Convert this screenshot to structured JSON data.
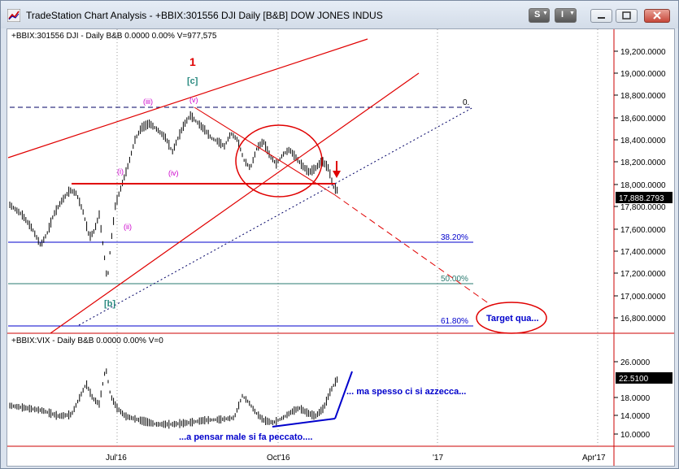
{
  "window": {
    "title": "TradeStation Chart Analysis - +BBIX:301556 DJI Daily [B&B] DOW JONES INDUS",
    "s_button": "S",
    "i_button": "I"
  },
  "upper_pane": {
    "header": "+BBIX:301556 DJI - Daily  B&B  0.0000  0.00%  V=977,575",
    "price_axis": [
      "19,200.0000",
      "19,000.0000",
      "18,800.0000",
      "18,600.0000",
      "18,400.0000",
      "18,200.0000",
      "18,000.0000",
      "17,800.0000",
      "17,600.0000",
      "17,400.0000",
      "17,200.0000",
      "17,000.0000",
      "16,800.0000"
    ],
    "last_price": "17,888.2793",
    "fib_top": "0.",
    "fib_382": "38.20%",
    "fib_50": "50.00%",
    "fib_618": "61.80%",
    "wave_1": "1",
    "wave_c": "[c]",
    "wave_b": "[b]",
    "wave_i": "(i)",
    "wave_ii": "(ii)",
    "wave_iii": "(iii)",
    "wave_iv": "(iv)",
    "wave_v": "(v)",
    "target_label": "Target qua..."
  },
  "lower_pane": {
    "header": "+BBIX:VIX - Daily  B&B  0.0000  0.00%  V=0",
    "price_axis": [
      "26.0000",
      "18.0000",
      "14.0000",
      "10.0000"
    ],
    "last_value": "22.5100",
    "note_top": "... ma spesso ci si azzecca...",
    "note_bottom": "...a pensar male si fa peccato...."
  },
  "time_axis": [
    "Jul'16",
    "Oct'16",
    "'17",
    "Apr'17"
  ],
  "colors": {
    "candle": "#000000",
    "trend": "#e00000",
    "fib": "#0000cc",
    "wave_labels": "#cc00cc",
    "wave_major": "#2a8a80",
    "annotation": "#0000cc"
  }
}
